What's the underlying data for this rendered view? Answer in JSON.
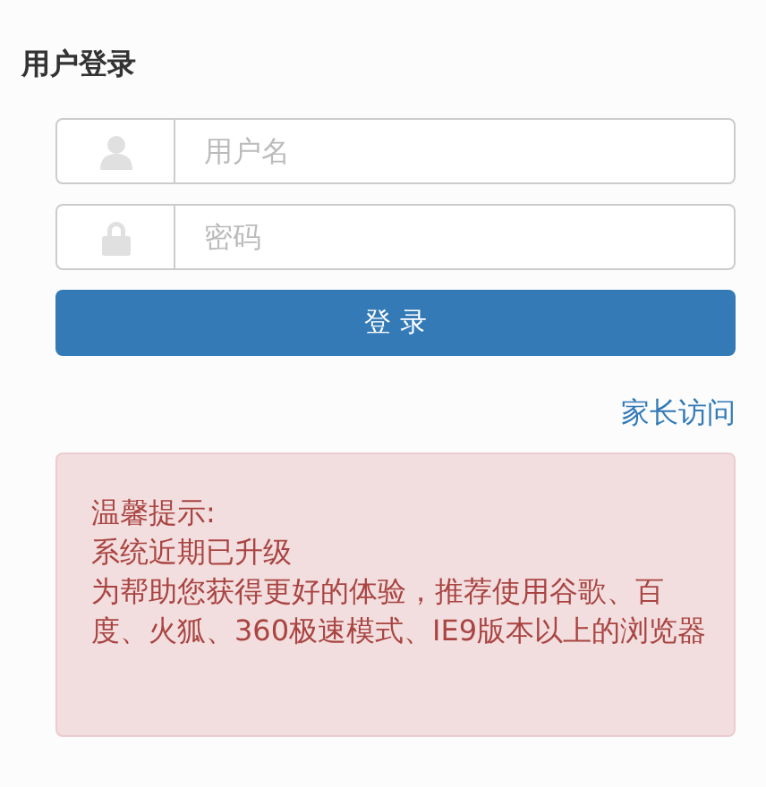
{
  "title": "用户登录",
  "fields": [
    {
      "kind": "user",
      "placeholder": "用户名"
    },
    {
      "kind": "password",
      "placeholder": "密码"
    }
  ],
  "login_button": "登 录",
  "parent_link": "家长访问",
  "notice": {
    "lines": [
      "温馨提示:",
      "系统近期已升级",
      "为帮助您获得更好的体验，推荐使用谷歌、百度、火狐、360极速模式、IE9版本以上的浏览器"
    ]
  }
}
